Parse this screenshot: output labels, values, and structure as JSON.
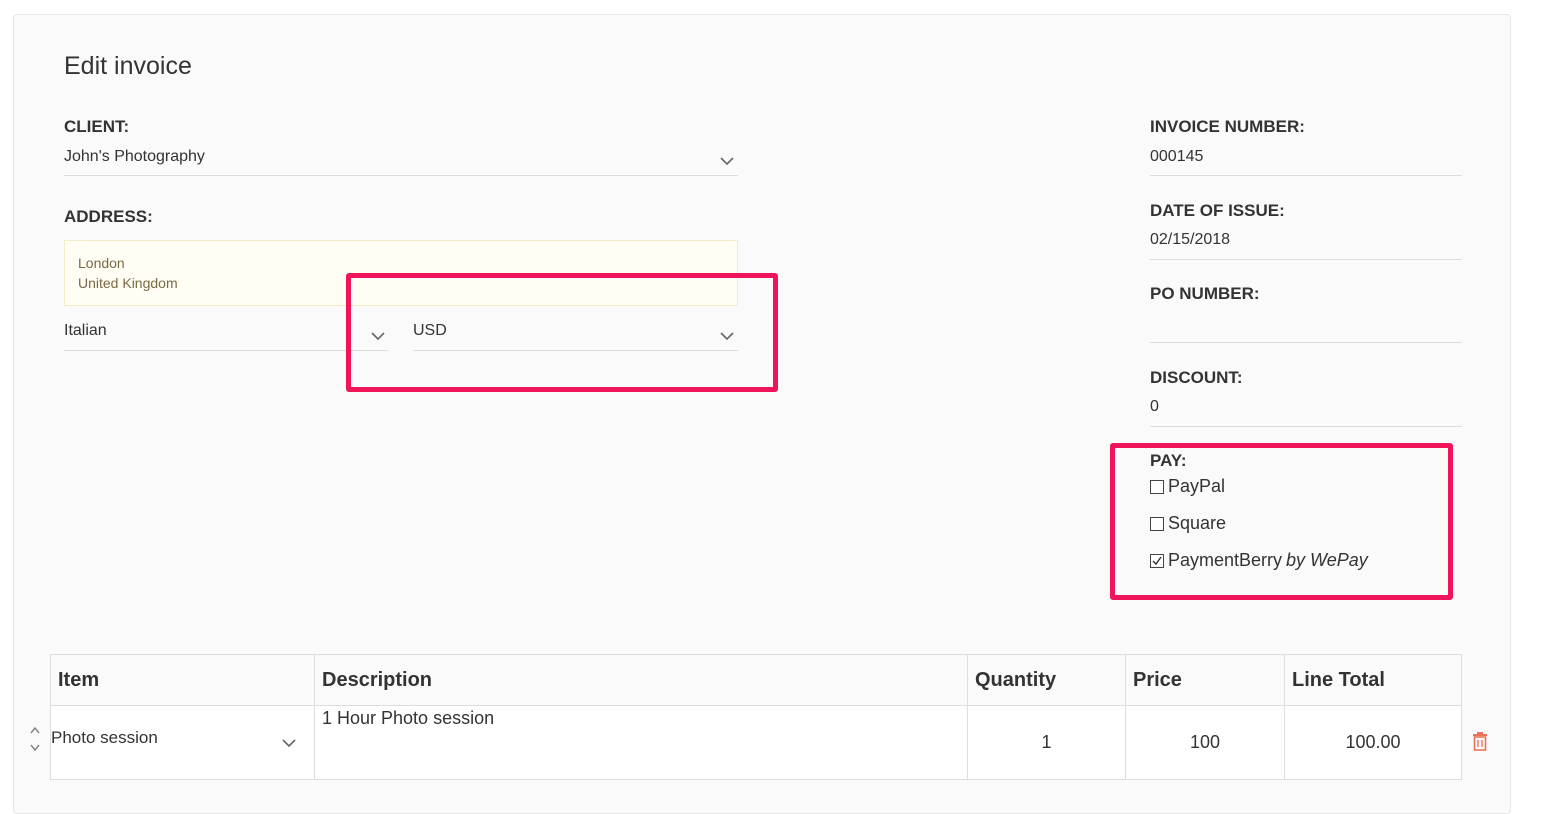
{
  "page": {
    "title": "Edit invoice"
  },
  "client": {
    "label": "CLIENT:",
    "value": "John's Photography"
  },
  "address": {
    "label": "ADDRESS:",
    "line1": "London",
    "line2": "United Kingdom"
  },
  "language": {
    "value": "Italian"
  },
  "currency": {
    "value": "USD"
  },
  "invoice_number": {
    "label": "INVOICE NUMBER:",
    "value": "000145"
  },
  "date_of_issue": {
    "label": "DATE OF ISSUE:",
    "value": "02/15/2018"
  },
  "po_number": {
    "label": "PO NUMBER:",
    "value": ""
  },
  "discount": {
    "label": "DISCOUNT:",
    "value": "0"
  },
  "pay": {
    "label": "PAY:",
    "options": [
      {
        "label": "PayPal",
        "checked": false
      },
      {
        "label": "Square",
        "checked": false
      },
      {
        "label": "PaymentBerry",
        "suffix": "by WePay",
        "checked": true
      }
    ]
  },
  "table": {
    "headers": [
      "Item",
      "Description",
      "Quantity",
      "Price",
      "Line Total"
    ],
    "rows": [
      {
        "item": "Photo session",
        "description": "1 Hour Photo session",
        "quantity": "1",
        "price": "100",
        "line_total": "100.00"
      }
    ]
  },
  "colors": {
    "highlight": "#f0145a",
    "trash": "#e8735a"
  },
  "icons": [
    "chevron-down-icon",
    "checkbox-icon",
    "checkmark-icon",
    "trash-icon",
    "sort-arrows-icon"
  ]
}
